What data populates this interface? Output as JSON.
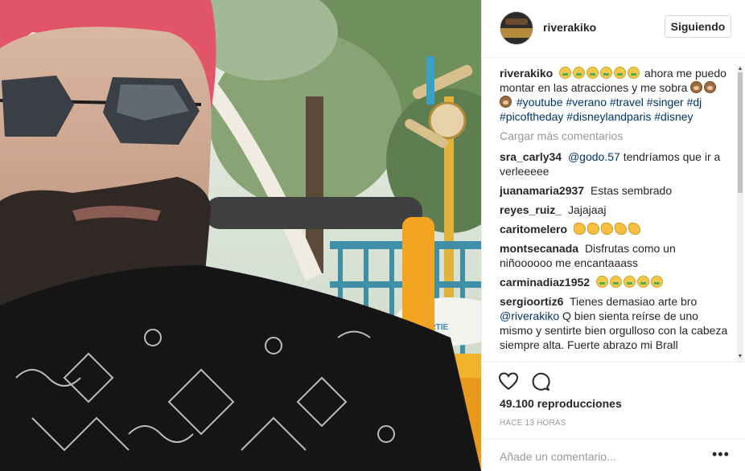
{
  "post": {
    "username": "riverakiko",
    "follow_label": "Siguiendo",
    "caption": {
      "user": "riverakiko",
      "text_a": "ahora me puedo montar en las atracciones y me sobra",
      "hashtags": [
        "#youtube",
        "#verano",
        "#travel",
        "#singer",
        "#dj",
        "#picoftheday",
        "#disneylandparis",
        "#disney"
      ],
      "emoji_money": "money-mouth-face-emoji",
      "emoji_monkey": "see-no-evil-monkey-emoji"
    },
    "load_more": "Cargar más comentarios",
    "comments": [
      {
        "user": "sra_carly34",
        "mention": "@godo.57",
        "text": "tendríamos que ir a verleeeee"
      },
      {
        "user": "juanamaria2937",
        "text": "Estas sembrado"
      },
      {
        "user": "reyes_ruiz_",
        "text": "Jajajaaj"
      },
      {
        "user": "caritomelero",
        "text": ""
      },
      {
        "user": "montsecanada",
        "text": "Disfrutas como un niñoooooo me encantaaass"
      },
      {
        "user": "carminadiaz1952",
        "text": ""
      },
      {
        "user": "sergioortiz6",
        "text_a": "Tienes demasiao arte bro",
        "mention": "@riverakiko",
        "text_b": "Q bien sienta reírse de uno mismo y sentirte bien orgulloso con la cabeza siempre alta. Fuerte abrazo mi Brall"
      }
    ],
    "views": "49.100 reproducciones",
    "time": "HACE 13 HORAS",
    "add_comment_placeholder": "Añade un comentario...",
    "icons": {
      "like": "heart-icon",
      "comment": "comment-bubble-icon",
      "more": "more-options-icon"
    }
  }
}
